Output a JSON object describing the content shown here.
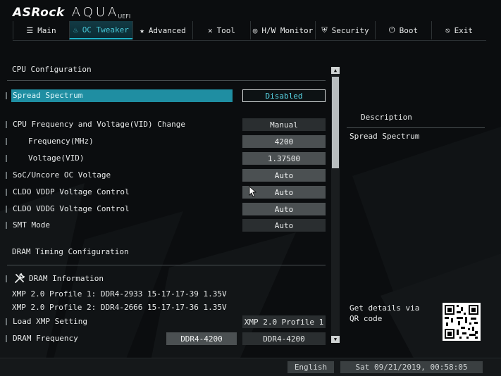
{
  "brand": {
    "name": "ASRock",
    "product": "AQUA",
    "sub": "UEFI"
  },
  "tabs": [
    {
      "label": "Main",
      "icon": "list-icon",
      "glyph": "☰",
      "active": false
    },
    {
      "label": "OC Tweaker",
      "icon": "flame-icon",
      "glyph": "♨",
      "active": true
    },
    {
      "label": "Advanced",
      "icon": "star-icon",
      "glyph": "★",
      "active": false
    },
    {
      "label": "Tool",
      "icon": "tools-icon",
      "glyph": "✕",
      "active": false
    },
    {
      "label": "H/W Monitor",
      "icon": "monitor-icon",
      "glyph": "◎",
      "active": false
    },
    {
      "label": "Security",
      "icon": "shield-icon",
      "glyph": "⛨",
      "active": false
    },
    {
      "label": "Boot",
      "icon": "power-icon",
      "glyph": "⏻",
      "active": false
    },
    {
      "label": "Exit",
      "icon": "exit-icon",
      "glyph": "⎋",
      "active": false
    }
  ],
  "cpu_section": {
    "title": "CPU Configuration"
  },
  "settings": {
    "spread_spectrum": {
      "label": "Spread Spectrum",
      "value": "Disabled"
    },
    "cpu_freq_voltage": {
      "label": "CPU Frequency and Voltage(VID) Change",
      "value": "Manual"
    },
    "frequency": {
      "label": "Frequency(MHz)",
      "value": "4200"
    },
    "voltage": {
      "label": "Voltage(VID)",
      "value": "1.37500"
    },
    "soc_uncore": {
      "label": "SoC/Uncore OC Voltage",
      "value": "Auto"
    },
    "cldo_vddp": {
      "label": "CLDO VDDP Voltage Control",
      "value": "Auto"
    },
    "cldo_vddg": {
      "label": "CLDO VDDG Voltage Control",
      "value": "Auto"
    },
    "smt_mode": {
      "label": "SMT Mode",
      "value": "Auto"
    }
  },
  "dram_section": {
    "title": "DRAM Timing Configuration"
  },
  "dram_info": {
    "label": "DRAM Information",
    "icon": "wrench-icon",
    "xmp1": "XMP 2.0 Profile 1: DDR4-2933 15-17-17-39 1.35V",
    "xmp2": "XMP 2.0 Profile 2: DDR4-2666 15-17-17-36 1.35V"
  },
  "dram_settings": {
    "load_xmp": {
      "label": "Load XMP Setting",
      "value": "XMP 2.0 Profile 1"
    },
    "dram_freq": {
      "label": "DRAM Frequency",
      "current": "DDR4-4200",
      "value": "DDR4-4200"
    }
  },
  "description": {
    "title": "Description",
    "text": "Spread Spectrum",
    "qr_text": "Get details via QR code"
  },
  "footer": {
    "language": "English",
    "datetime": "Sat 09/21/2019, 00:58:05"
  },
  "colors": {
    "accent": "#1fb3c9",
    "selected_row": "#1f8ea2",
    "background": "#0b0d0f"
  }
}
